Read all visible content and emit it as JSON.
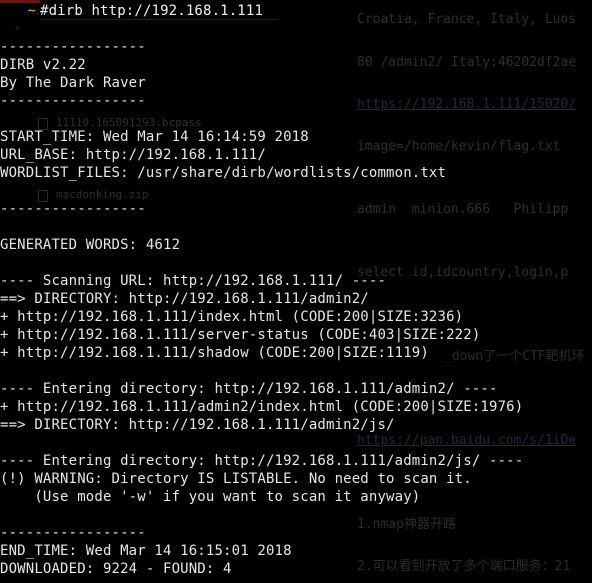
{
  "terminal": {
    "prompt_symbol": "~",
    "command": "#dirb http://192.168.1.111",
    "output_lines": [
      "",
      "-----------------",
      "DIRB v2.22",
      "By The Dark Raver",
      "-----------------",
      "",
      "START_TIME: Wed Mar 14 16:14:59 2018",
      "URL_BASE: http://192.168.1.111/",
      "WORDLIST_FILES: /usr/share/dirb/wordlists/common.txt",
      "",
      "-----------------",
      "",
      "GENERATED WORDS: 4612",
      "",
      "---- Scanning URL: http://192.168.1.111/ ----",
      "==> DIRECTORY: http://192.168.1.111/admin2/",
      "+ http://192.168.1.111/index.html (CODE:200|SIZE:3236)",
      "+ http://192.168.1.111/server-status (CODE:403|SIZE:222)",
      "+ http://192.168.1.111/shadow (CODE:200|SIZE:1119)",
      "",
      "---- Entering directory: http://192.168.1.111/admin2/ ----",
      "+ http://192.168.1.111/admin2/index.html (CODE:200|SIZE:1976)",
      "==> DIRECTORY: http://192.168.1.111/admin2/js/",
      "",
      "---- Entering directory: http://192.168.1.111/admin2/js/ ----",
      "(!) WARNING: Directory IS LISTABLE. No need to scan it.",
      "    (Use mode '-w' if you want to scan it anyway)",
      "",
      "-----------------",
      "END_TIME: Wed Mar 14 16:15:01 2018",
      "DOWNLOADED: 9224 - FOUND: 4"
    ]
  },
  "background_document": {
    "lines": [
      "Croatia, France, Italy, Luos",
      "80 /admin2/ Italy:46202df2ae",
      "https://192.168.1.111/15020/",
      "image=/home/kevin/flag.txt",
      "admin  minion.666   Philipp",
      "select id,idcountry,login,p",
      "_down了一个CTF靶机环",
      "https://pan.baidu.com/s/1iDe",
      "1.nmap神器开路",
      "2.可以看到开放了多个端口服务：21"
    ],
    "file_names": [
      "11110.165091293.bcpass",
      "macdonking.zip"
    ]
  },
  "colors": {
    "background": "#000000",
    "text": "#e6e6e6",
    "prompt": "#e8b800"
  }
}
